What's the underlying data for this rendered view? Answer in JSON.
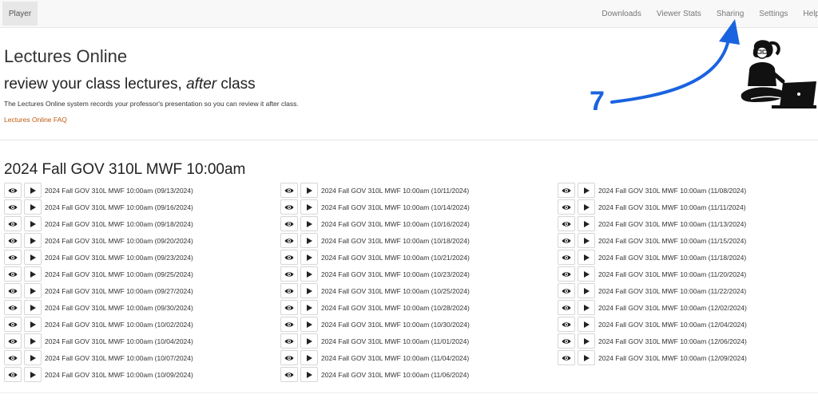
{
  "navbar": {
    "active_tab": "Player",
    "links": [
      "Downloads",
      "Viewer Stats",
      "Sharing",
      "Settings",
      "Help"
    ]
  },
  "header": {
    "title": "Lectures Online",
    "subtitle_prefix": "review your class lectures, ",
    "subtitle_emphasis": "after",
    "subtitle_suffix": " class",
    "description": "The Lectures Online system records your professor's presentation so you can review it after class.",
    "faq_link": "Lectures Online FAQ"
  },
  "course": {
    "title": "2024 Fall GOV 310L MWF 10:00am",
    "columns": [
      [
        "2024 Fall GOV 310L MWF 10:00am (09/13/2024)",
        "2024 Fall GOV 310L MWF 10:00am (09/16/2024)",
        "2024 Fall GOV 310L MWF 10:00am (09/18/2024)",
        "2024 Fall GOV 310L MWF 10:00am (09/20/2024)",
        "2024 Fall GOV 310L MWF 10:00am (09/23/2024)",
        "2024 Fall GOV 310L MWF 10:00am (09/25/2024)",
        "2024 Fall GOV 310L MWF 10:00am (09/27/2024)",
        "2024 Fall GOV 310L MWF 10:00am (09/30/2024)",
        "2024 Fall GOV 310L MWF 10:00am (10/02/2024)",
        "2024 Fall GOV 310L MWF 10:00am (10/04/2024)",
        "2024 Fall GOV 310L MWF 10:00am (10/07/2024)",
        "2024 Fall GOV 310L MWF 10:00am (10/09/2024)"
      ],
      [
        "2024 Fall GOV 310L MWF 10:00am (10/11/2024)",
        "2024 Fall GOV 310L MWF 10:00am (10/14/2024)",
        "2024 Fall GOV 310L MWF 10:00am (10/16/2024)",
        "2024 Fall GOV 310L MWF 10:00am (10/18/2024)",
        "2024 Fall GOV 310L MWF 10:00am (10/21/2024)",
        "2024 Fall GOV 310L MWF 10:00am (10/23/2024)",
        "2024 Fall GOV 310L MWF 10:00am (10/25/2024)",
        "2024 Fall GOV 310L MWF 10:00am (10/28/2024)",
        "2024 Fall GOV 310L MWF 10:00am (10/30/2024)",
        "2024 Fall GOV 310L MWF 10:00am (11/01/2024)",
        "2024 Fall GOV 310L MWF 10:00am (11/04/2024)",
        "2024 Fall GOV 310L MWF 10:00am (11/06/2024)"
      ],
      [
        "2024 Fall GOV 310L MWF 10:00am (11/08/2024)",
        "2024 Fall GOV 310L MWF 10:00am (11/11/2024)",
        "2024 Fall GOV 310L MWF 10:00am (11/13/2024)",
        "2024 Fall GOV 310L MWF 10:00am (11/15/2024)",
        "2024 Fall GOV 310L MWF 10:00am (11/18/2024)",
        "2024 Fall GOV 310L MWF 10:00am (11/20/2024)",
        "2024 Fall GOV 310L MWF 10:00am (11/22/2024)",
        "2024 Fall GOV 310L MWF 10:00am (12/02/2024)",
        "2024 Fall GOV 310L MWF 10:00am (12/04/2024)",
        "2024 Fall GOV 310L MWF 10:00am (12/06/2024)",
        "2024 Fall GOV 310L MWF 10:00am (12/09/2024)"
      ]
    ]
  },
  "annotation": {
    "step_number": "7",
    "color": "#1a63e0"
  },
  "icons": {
    "view": "eye-icon",
    "play": "play-icon",
    "illustration": "person-with-laptop-icon"
  }
}
